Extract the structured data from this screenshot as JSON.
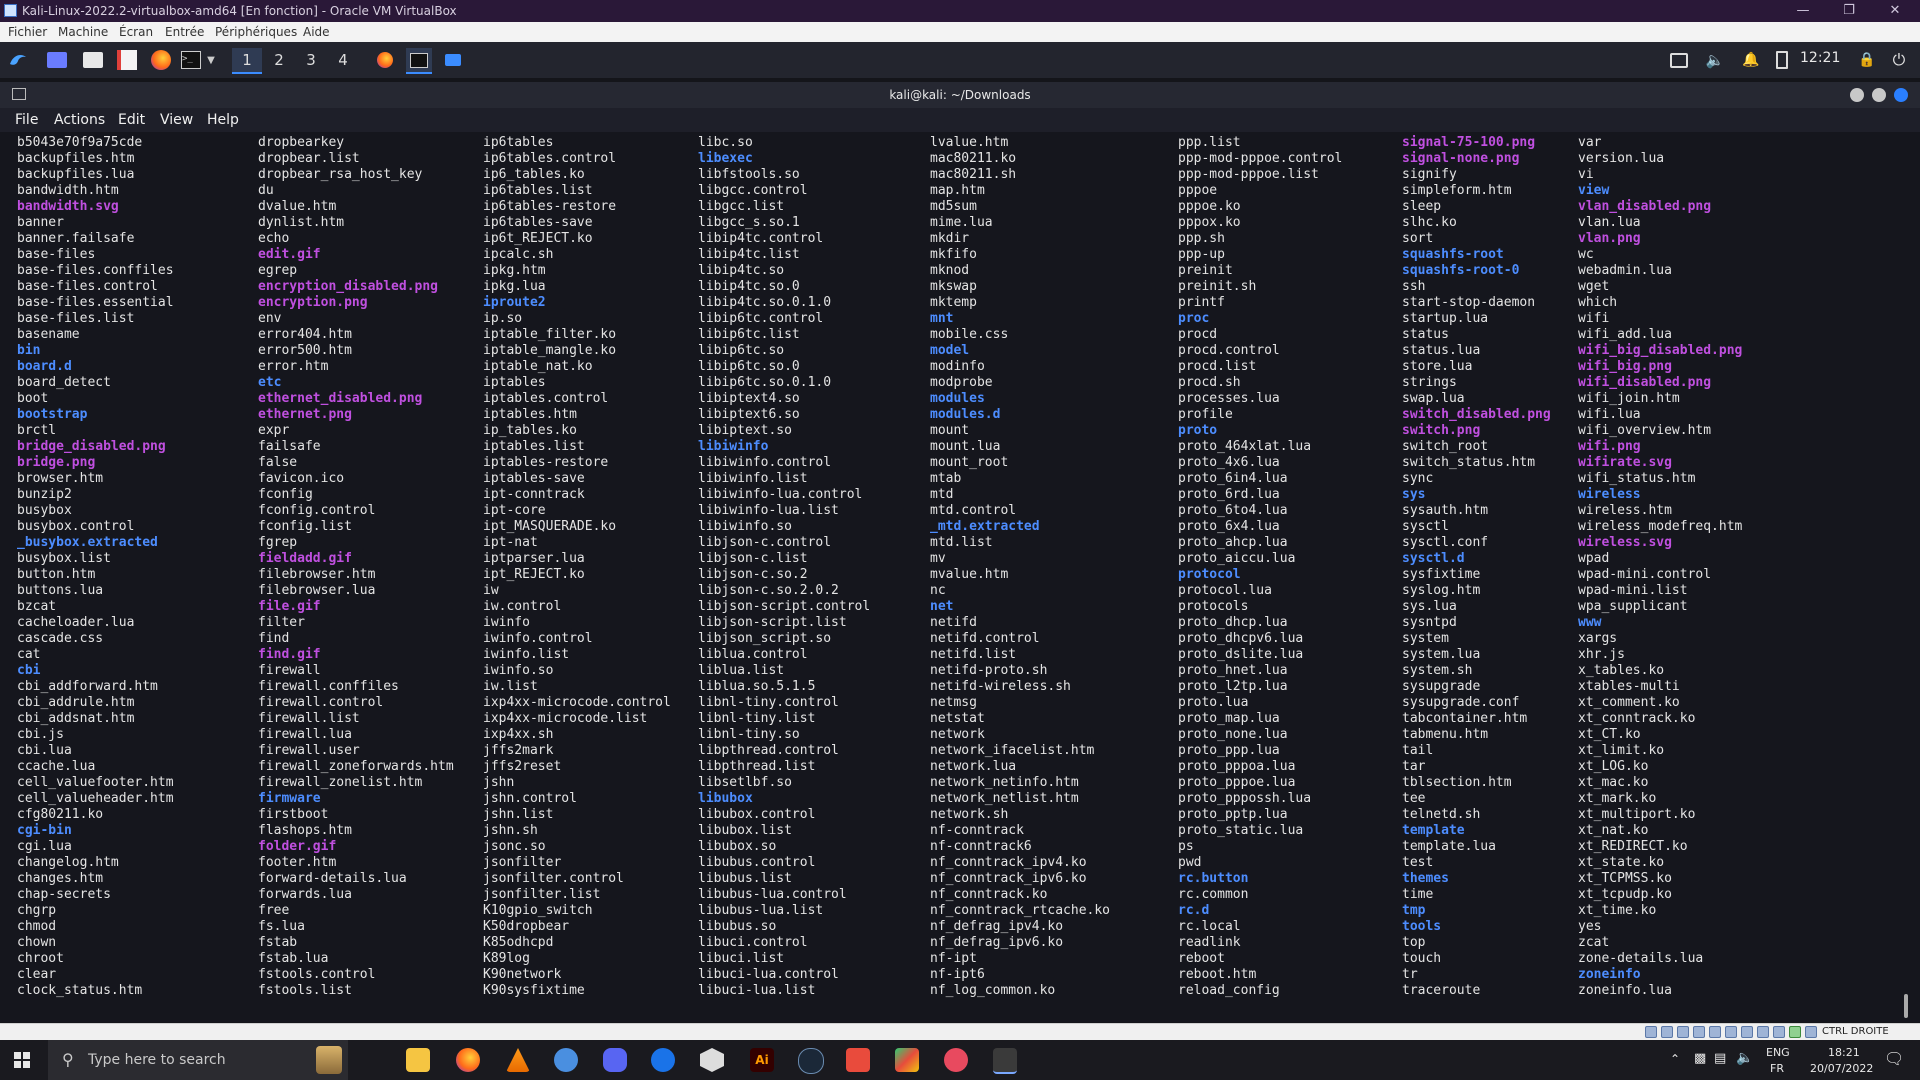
{
  "vbox": {
    "title": "Kali-Linux-2022.2-virtualbox-amd64 [En fonction] - Oracle VM VirtualBox",
    "menu": [
      "Fichier",
      "Machine",
      "Écran",
      "Entrée",
      "Périphériques",
      "Aide"
    ],
    "status_right": "CTRL DROITE"
  },
  "panel": {
    "workspaces": [
      "1",
      "2",
      "3",
      "4"
    ],
    "clock": "12:21"
  },
  "terminal": {
    "title": "kali@kali: ~/Downloads",
    "menu": [
      "File",
      "Actions",
      "Edit",
      "View",
      "Help"
    ],
    "columns": [
      [
        "b5043e70f9a75cde",
        "backupfiles.htm",
        "backupfiles.lua",
        "bandwidth.htm",
        "bandwidth.svg",
        "banner",
        "banner.failsafe",
        "base-files",
        "base-files.conffiles",
        "base-files.control",
        "base-files.essential",
        "base-files.list",
        "basename",
        "bin",
        "board.d",
        "board_detect",
        "boot",
        "bootstrap",
        "brctl",
        "bridge_disabled.png",
        "bridge.png",
        "browser.htm",
        "bunzip2",
        "busybox",
        "busybox.control",
        "_busybox.extracted",
        "busybox.list",
        "button.htm",
        "buttons.lua",
        "bzcat",
        "cacheloader.lua",
        "cascade.css",
        "cat",
        "cbi",
        "cbi_addforward.htm",
        "cbi_addrule.htm",
        "cbi_addsnat.htm",
        "cbi.js",
        "cbi.lua",
        "ccache.lua",
        "cell_valuefooter.htm",
        "cell_valueheader.htm",
        "cfg80211.ko",
        "cgi-bin",
        "cgi.lua",
        "changelog.htm",
        "changes.htm",
        "chap-secrets",
        "chgrp",
        "chmod",
        "chown",
        "chroot",
        "clear",
        "clock_status.htm"
      ],
      [
        "dropbearkey",
        "dropbear.list",
        "dropbear_rsa_host_key",
        "du",
        "dvalue.htm",
        "dynlist.htm",
        "echo",
        "edit.gif",
        "egrep",
        "encryption_disabled.png",
        "encryption.png",
        "env",
        "error404.htm",
        "error500.htm",
        "error.htm",
        "etc",
        "ethernet_disabled.png",
        "ethernet.png",
        "expr",
        "failsafe",
        "false",
        "favicon.ico",
        "fconfig",
        "fconfig.control",
        "fconfig.list",
        "fgrep",
        "fieldadd.gif",
        "filebrowser.htm",
        "filebrowser.lua",
        "file.gif",
        "filter",
        "find",
        "find.gif",
        "firewall",
        "firewall.conffiles",
        "firewall.control",
        "firewall.list",
        "firewall.lua",
        "firewall.user",
        "firewall_zoneforwards.htm",
        "firewall_zonelist.htm",
        "firmware",
        "firstboot",
        "flashops.htm",
        "folder.gif",
        "footer.htm",
        "forward-details.lua",
        "forwards.lua",
        "free",
        "fs.lua",
        "fstab",
        "fstab.lua",
        "fstools.control",
        "fstools.list"
      ],
      [
        "ip6tables",
        "ip6tables.control",
        "ip6_tables.ko",
        "ip6tables.list",
        "ip6tables-restore",
        "ip6tables-save",
        "ip6t_REJECT.ko",
        "ipcalc.sh",
        "ipkg.htm",
        "ipkg.lua",
        "iproute2",
        "ip.so",
        "iptable_filter.ko",
        "iptable_mangle.ko",
        "iptable_nat.ko",
        "iptables",
        "iptables.control",
        "iptables.htm",
        "ip_tables.ko",
        "iptables.list",
        "iptables-restore",
        "iptables-save",
        "ipt-conntrack",
        "ipt-core",
        "ipt_MASQUERADE.ko",
        "ipt-nat",
        "iptparser.lua",
        "ipt_REJECT.ko",
        "iw",
        "iw.control",
        "iwinfo",
        "iwinfo.control",
        "iwinfo.list",
        "iwinfo.so",
        "iw.list",
        "ixp4xx-microcode.control",
        "ixp4xx-microcode.list",
        "ixp4xx.sh",
        "jffs2mark",
        "jffs2reset",
        "jshn",
        "jshn.control",
        "jshn.list",
        "jshn.sh",
        "jsonc.so",
        "jsonfilter",
        "jsonfilter.control",
        "jsonfilter.list",
        "K10gpio_switch",
        "K50dropbear",
        "K85odhcpd",
        "K89log",
        "K90network",
        "K90sysfixtime"
      ],
      [
        "libc.so",
        "libexec",
        "libfstools.so",
        "libgcc.control",
        "libgcc.list",
        "libgcc_s.so.1",
        "libip4tc.control",
        "libip4tc.list",
        "libip4tc.so",
        "libip4tc.so.0",
        "libip4tc.so.0.1.0",
        "libip6tc.control",
        "libip6tc.list",
        "libip6tc.so",
        "libip6tc.so.0",
        "libip6tc.so.0.1.0",
        "libiptext4.so",
        "libiptext6.so",
        "libiptext.so",
        "libiwinfo",
        "libiwinfo.control",
        "libiwinfo.list",
        "libiwinfo-lua.control",
        "libiwinfo-lua.list",
        "libiwinfo.so",
        "libjson-c.control",
        "libjson-c.list",
        "libjson-c.so.2",
        "libjson-c.so.2.0.2",
        "libjson-script.control",
        "libjson-script.list",
        "libjson_script.so",
        "liblua.control",
        "liblua.list",
        "liblua.so.5.1.5",
        "libnl-tiny.control",
        "libnl-tiny.list",
        "libnl-tiny.so",
        "libpthread.control",
        "libpthread.list",
        "libsetlbf.so",
        "libubox",
        "libubox.control",
        "libubox.list",
        "libubox.so",
        "libubus.control",
        "libubus.list",
        "libubus-lua.control",
        "libubus-lua.list",
        "libubus.so",
        "libuci.control",
        "libuci.list",
        "libuci-lua.control",
        "libuci-lua.list"
      ],
      [
        "lvalue.htm",
        "mac80211.ko",
        "mac80211.sh",
        "map.htm",
        "md5sum",
        "mime.lua",
        "mkdir",
        "mkfifo",
        "mknod",
        "mkswap",
        "mktemp",
        "mnt",
        "mobile.css",
        "model",
        "modinfo",
        "modprobe",
        "modules",
        "modules.d",
        "mount",
        "mount.lua",
        "mount_root",
        "mtab",
        "mtd",
        "mtd.control",
        "_mtd.extracted",
        "mtd.list",
        "mv",
        "mvalue.htm",
        "nc",
        "net",
        "netifd",
        "netifd.control",
        "netifd.list",
        "netifd-proto.sh",
        "netifd-wireless.sh",
        "netmsg",
        "netstat",
        "network",
        "network_ifacelist.htm",
        "network.lua",
        "network_netinfo.htm",
        "network_netlist.htm",
        "network.sh",
        "nf-conntrack",
        "nf-conntrack6",
        "nf_conntrack_ipv4.ko",
        "nf_conntrack_ipv6.ko",
        "nf_conntrack.ko",
        "nf_conntrack_rtcache.ko",
        "nf_defrag_ipv4.ko",
        "nf_defrag_ipv6.ko",
        "nf-ipt",
        "nf-ipt6",
        "nf_log_common.ko"
      ],
      [
        "ppp.list",
        "ppp-mod-pppoe.control",
        "ppp-mod-pppoe.list",
        "pppoe",
        "pppoe.ko",
        "pppox.ko",
        "ppp.sh",
        "ppp-up",
        "preinit",
        "preinit.sh",
        "printf",
        "proc",
        "procd",
        "procd.control",
        "procd.list",
        "procd.sh",
        "processes.lua",
        "profile",
        "proto",
        "proto_464xlat.lua",
        "proto_4x6.lua",
        "proto_6in4.lua",
        "proto_6rd.lua",
        "proto_6to4.lua",
        "proto_6x4.lua",
        "proto_ahcp.lua",
        "proto_aiccu.lua",
        "protocol",
        "protocol.lua",
        "protocols",
        "proto_dhcp.lua",
        "proto_dhcpv6.lua",
        "proto_dslite.lua",
        "proto_hnet.lua",
        "proto_l2tp.lua",
        "proto.lua",
        "proto_map.lua",
        "proto_none.lua",
        "proto_ppp.lua",
        "proto_pppoa.lua",
        "proto_pppoe.lua",
        "proto_pppossh.lua",
        "proto_pptp.lua",
        "proto_static.lua",
        "ps",
        "pwd",
        "rc.button",
        "rc.common",
        "rc.d",
        "rc.local",
        "readlink",
        "reboot",
        "reboot.htm",
        "reload_config"
      ],
      [
        "signal-75-100.png",
        "signal-none.png",
        "signify",
        "simpleform.htm",
        "sleep",
        "slhc.ko",
        "sort",
        "squashfs-root",
        "squashfs-root-0",
        "ssh",
        "start-stop-daemon",
        "startup.lua",
        "status",
        "status.lua",
        "store.lua",
        "strings",
        "swap.lua",
        "switch_disabled.png",
        "switch.png",
        "switch_root",
        "switch_status.htm",
        "sync",
        "sys",
        "sysauth.htm",
        "sysctl",
        "sysctl.conf",
        "sysctl.d",
        "sysfixtime",
        "syslog.htm",
        "sys.lua",
        "sysntpd",
        "system",
        "system.lua",
        "system.sh",
        "sysupgrade",
        "sysupgrade.conf",
        "tabcontainer.htm",
        "tabmenu.htm",
        "tail",
        "tar",
        "tblsection.htm",
        "tee",
        "telnetd.sh",
        "template",
        "template.lua",
        "test",
        "themes",
        "time",
        "tmp",
        "tools",
        "top",
        "touch",
        "tr",
        "traceroute"
      ],
      [
        "var",
        "version.lua",
        "vi",
        "view",
        "vlan_disabled.png",
        "vlan.lua",
        "vlan.png",
        "wc",
        "webadmin.lua",
        "wget",
        "which",
        "wifi",
        "wifi_add.lua",
        "wifi_big_disabled.png",
        "wifi_big.png",
        "wifi_disabled.png",
        "wifi_join.htm",
        "wifi.lua",
        "wifi_overview.htm",
        "wifi.png",
        "wifirate.svg",
        "wifi_status.htm",
        "wireless",
        "wireless.htm",
        "wireless_modefreq.htm",
        "wireless.svg",
        "wpad",
        "wpad-mini.control",
        "wpad-mini.list",
        "wpa_supplicant",
        "www",
        "xargs",
        "xhr.js",
        "x_tables.ko",
        "xtables-multi",
        "xt_comment.ko",
        "xt_conntrack.ko",
        "xt_CT.ko",
        "xt_limit.ko",
        "xt_LOG.ko",
        "xt_mac.ko",
        "xt_mark.ko",
        "xt_multiport.ko",
        "xt_nat.ko",
        "xt_REDIRECT.ko",
        "xt_state.ko",
        "xt_TCPMSS.ko",
        "xt_tcpudp.ko",
        "xt_time.ko",
        "yes",
        "zcat",
        "zone-details.lua",
        "zoneinfo",
        "zoneinfo.lua"
      ]
    ],
    "dirs": [
      "bin",
      "board.d",
      "bootstrap",
      "_busybox.extracted",
      "cbi",
      "cgi-bin",
      "etc",
      "firmware",
      "iproute2",
      "libexec",
      "libiwinfo",
      "libubox",
      "mnt",
      "model",
      "modules",
      "modules.d",
      "_mtd.extracted",
      "net",
      "proc",
      "proto",
      "protocol",
      "rc.button",
      "rc.d",
      "squashfs-root",
      "squashfs-root-0",
      "sys",
      "sysctl.d",
      "template",
      "themes",
      "tmp",
      "tools",
      "view",
      "wireless",
      "www",
      "zoneinfo"
    ],
    "images": [
      "bandwidth.svg",
      "bridge_disabled.png",
      "bridge.png",
      "edit.gif",
      "encryption_disabled.png",
      "encryption.png",
      "ethernet_disabled.png",
      "ethernet.png",
      "fieldadd.gif",
      "file.gif",
      "find.gif",
      "folder.gif",
      "signal-75-100.png",
      "signal-none.png",
      "switch_disabled.png",
      "switch.png",
      "vlan_disabled.png",
      "vlan.png",
      "wifi_big_disabled.png",
      "wifi_big.png",
      "wifi_disabled.png",
      "wifi.png",
      "wifirate.svg",
      "wireless.svg"
    ]
  },
  "taskbar": {
    "search_placeholder": "Type here to search",
    "lang": "ENG",
    "region": "FR",
    "time": "18:21",
    "date": "20/07/2022"
  },
  "colors": {
    "directory": "#4d8dff",
    "image_file": "#c050e0",
    "default_text": "#e4e4e4",
    "accent": "#3b8cff"
  }
}
